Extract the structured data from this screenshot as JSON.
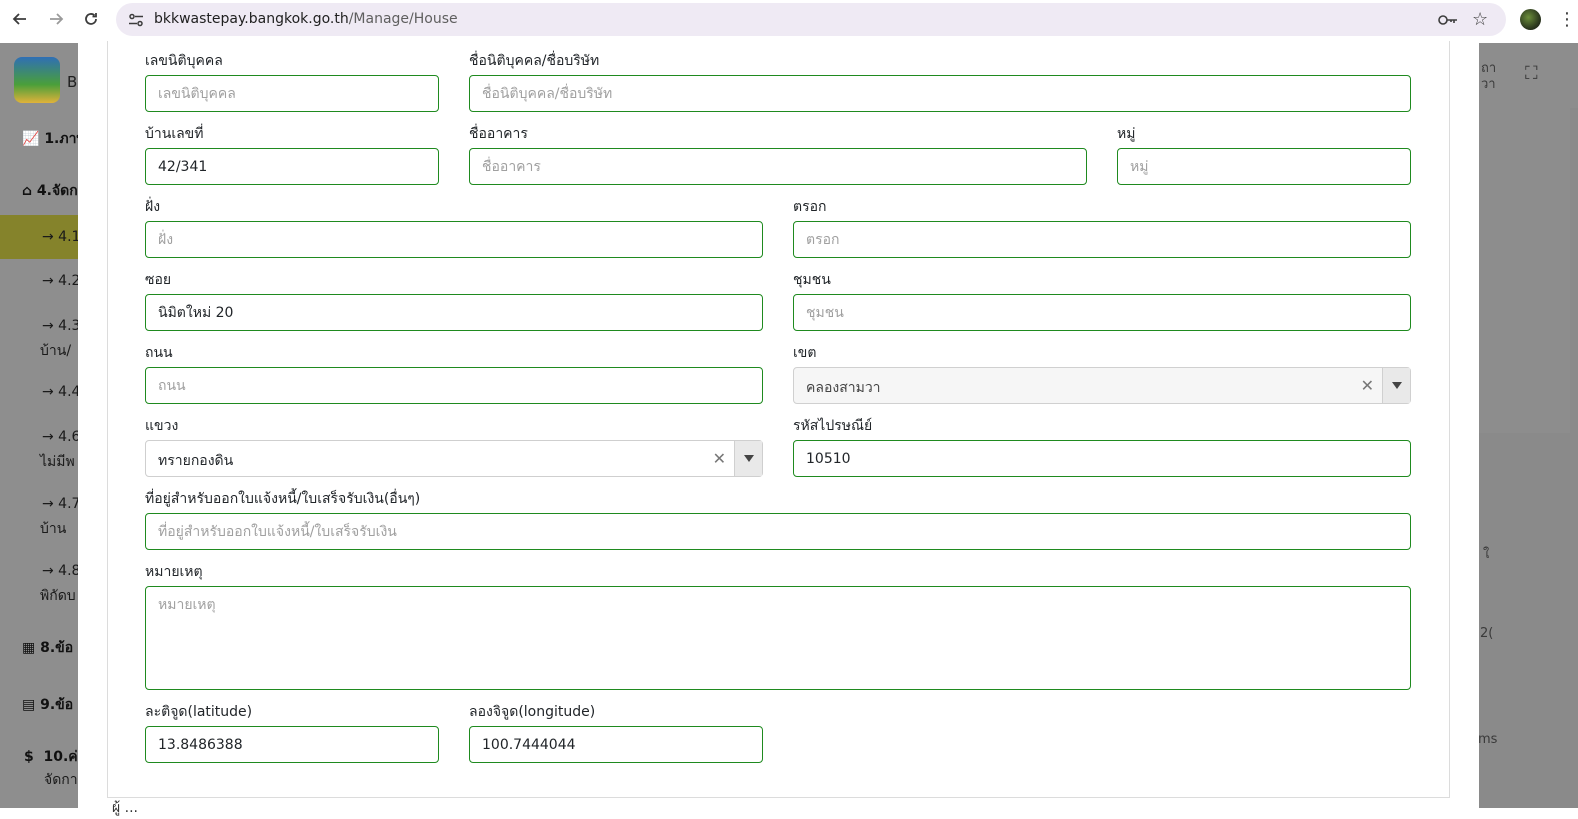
{
  "browser": {
    "url_host": "bkkwastepay.bangkok.go.th",
    "url_path": "/Manage/House"
  },
  "sidebar": {
    "logo_letter": "B",
    "items": [
      {
        "label": "1.ภาพ"
      },
      {
        "label": "4.จัดก"
      },
      {
        "label": "→ 4.1"
      },
      {
        "label": "→ 4.2"
      },
      {
        "label": "→ 4.3"
      },
      {
        "label": "บ้าน/"
      },
      {
        "label": "→ 4.4"
      },
      {
        "label": "→ 4.6"
      },
      {
        "label": "ไม่มีพ"
      },
      {
        "label": "→ 4.7"
      },
      {
        "label": "บ้าน"
      },
      {
        "label": "→ 4.8"
      },
      {
        "label": "พิกัดบ"
      },
      {
        "label": "8.ข้อ"
      },
      {
        "label": "9.ข้อ"
      },
      {
        "label": "10.ค่า"
      },
      {
        "label": "จัดกา"
      }
    ],
    "dollar": "$"
  },
  "right_bg": {
    "t1": "ถา",
    "t2": "วา",
    "t3": "ใ",
    "t4": "2(",
    "t5": "ms"
  },
  "form": {
    "juristic_id": {
      "label": "เลขนิติบุคคล",
      "placeholder": "เลขนิติบุคคล",
      "value": ""
    },
    "company_name": {
      "label": "ชื่อนิติบุคคล/ชื่อบริษัท",
      "placeholder": "ชื่อนิติบุคคล/ชื่อบริษัท",
      "value": ""
    },
    "house_no": {
      "label": "บ้านเลขที่",
      "placeholder": "",
      "value": "42/341"
    },
    "building": {
      "label": "ชื่ออาคาร",
      "placeholder": "ชื่ออาคาร",
      "value": ""
    },
    "moo": {
      "label": "หมู่",
      "placeholder": "หมู่",
      "value": ""
    },
    "fang": {
      "label": "ฝั่ง",
      "placeholder": "ฝั่ง",
      "value": ""
    },
    "trok": {
      "label": "ตรอก",
      "placeholder": "ตรอก",
      "value": ""
    },
    "soi": {
      "label": "ซอย",
      "placeholder": "",
      "value": "นิมิตใหม่ 20"
    },
    "community": {
      "label": "ชุมชน",
      "placeholder": "ชุมชน",
      "value": ""
    },
    "road": {
      "label": "ถนน",
      "placeholder": "ถนน",
      "value": ""
    },
    "district": {
      "label": "เขต",
      "value": "คลองสามวา"
    },
    "subdistrict": {
      "label": "แขวง",
      "value": "ทรายกองดิน"
    },
    "postcode": {
      "label": "รหัสไปรษณีย์",
      "placeholder": "",
      "value": "10510"
    },
    "billing_address": {
      "label": "ที่อยู่สำหรับออกใบแจ้งหนี้/ใบเสร็จรับเงิน(อื่นๆ)",
      "placeholder": "ที่อยู่สำหรับออกใบแจ้งหนี้/ใบเสร็จรับเงิน",
      "value": ""
    },
    "remark": {
      "label": "หมายเหตุ",
      "placeholder": "หมายเหตุ",
      "value": ""
    },
    "latitude": {
      "label": "ละติจูด(latitude)",
      "placeholder": "",
      "value": "13.8486388"
    },
    "longitude": {
      "label": "ลองจิจูด(longitude)",
      "placeholder": "",
      "value": "100.7444044"
    }
  },
  "bottom_text": "ผู้ ..."
}
